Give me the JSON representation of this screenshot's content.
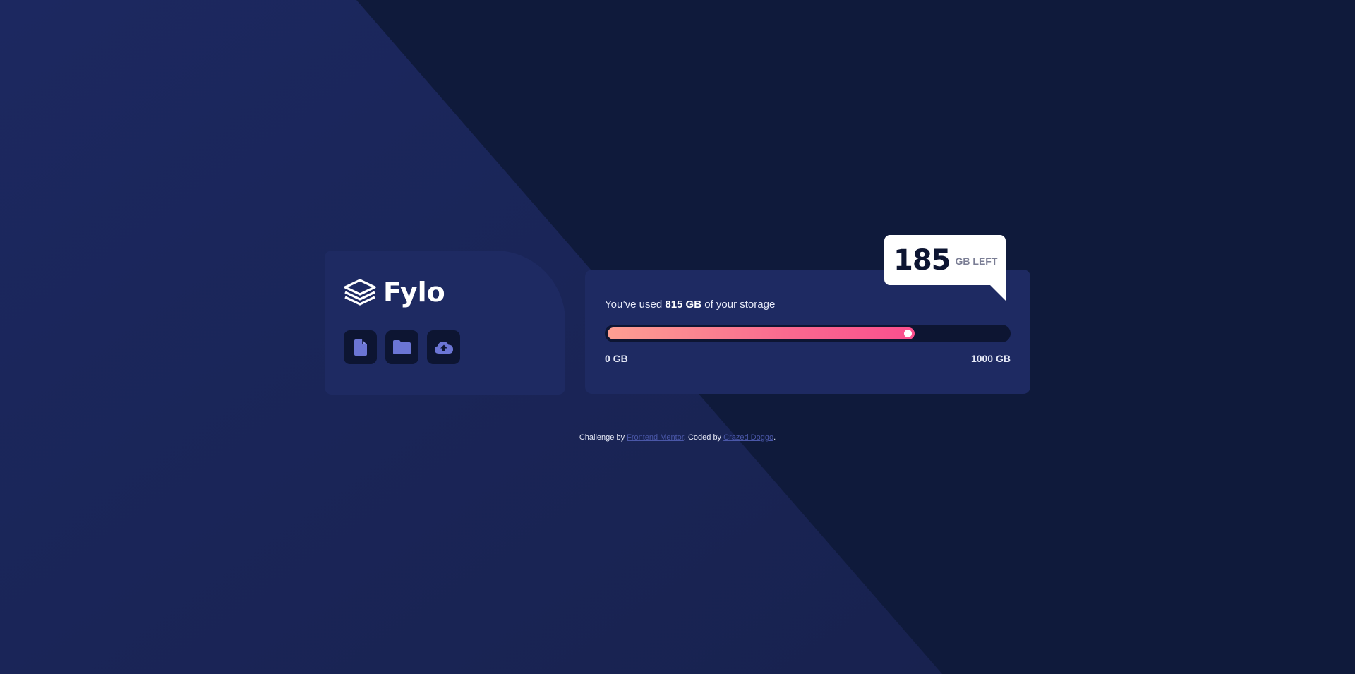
{
  "colors": {
    "background_dark": "#0f1a3b",
    "background_light": "#1b2658",
    "card": "#1e2a62",
    "icon_bg": "#0d1532",
    "icon_fg": "#6b75d4",
    "gradient_start": "#fd9f92",
    "gradient_end": "#fa4f8e",
    "link": "#4a57a8"
  },
  "logo": {
    "text": "Fylo",
    "icon": "layers-icon"
  },
  "toolbar": {
    "icons": [
      "document-icon",
      "folder-icon",
      "cloud-upload-icon"
    ]
  },
  "storage": {
    "prefix": "You’ve used ",
    "used": "815 GB",
    "suffix": " of your storage",
    "min_label": "0 GB",
    "max_label": "1000 GB",
    "used_gb": 815,
    "total_gb": 1000
  },
  "bubble": {
    "number": "185",
    "unit": "GB LEFT"
  },
  "attribution": {
    "prefix": "Challenge by ",
    "link1": "Frontend Mentor",
    "middle": ". Coded by ",
    "link2": "Crazed Doggo",
    "suffix": "."
  }
}
